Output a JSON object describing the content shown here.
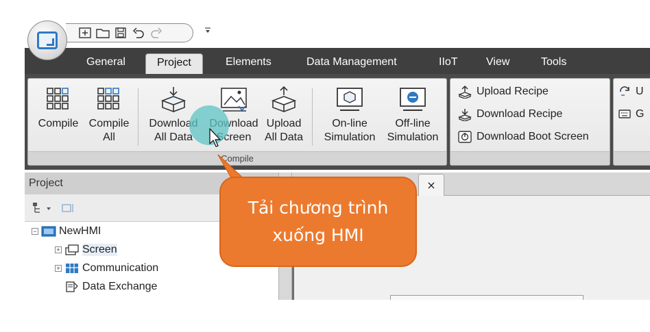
{
  "menu": {
    "tabs": [
      "General",
      "Project",
      "Elements",
      "Data Management",
      "IIoT",
      "View",
      "Tools"
    ],
    "active": "Project"
  },
  "ribbon": {
    "group_compile": {
      "buttons": [
        {
          "line1": "Compile",
          "line2": ""
        },
        {
          "line1": "Compile",
          "line2": "All"
        },
        {
          "line1": "Download",
          "line2": "All Data"
        },
        {
          "line1": "Download",
          "line2": "Screen"
        },
        {
          "line1": "Upload",
          "line2": "All Data"
        },
        {
          "line1": "On-line",
          "line2": "Simulation"
        },
        {
          "line1": "Off-line",
          "line2": "Simulation"
        }
      ],
      "footer": "Compile"
    },
    "group_recipe": {
      "items": [
        "Upload Recipe",
        "Download Recipe",
        "Download Boot Screen"
      ]
    },
    "group_partial": {
      "items": [
        "U",
        "G"
      ]
    }
  },
  "project_panel": {
    "title": "Project",
    "tree": {
      "root": "NewHMI",
      "children": [
        "Screen",
        "Communication",
        "Data Exchange"
      ]
    }
  },
  "editor": {
    "close_glyph": "×"
  },
  "callout": {
    "line1": "Tải chương trình",
    "line2": "xuống HMI"
  },
  "colors": {
    "callout": "#ec7a2e",
    "menubar": "#3f3f3f",
    "accent": "#2f79c2"
  }
}
